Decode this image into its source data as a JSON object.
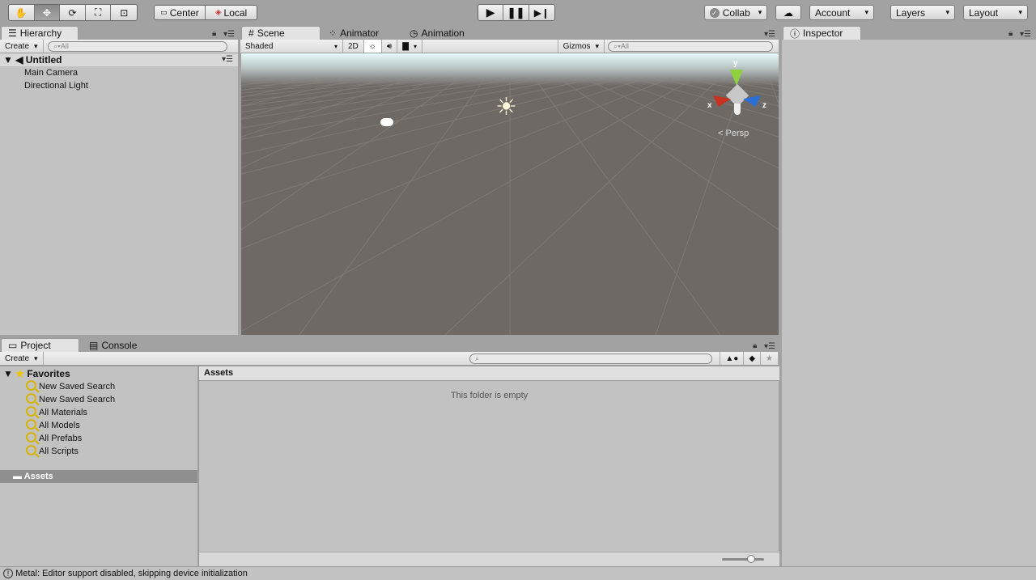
{
  "toolbar": {
    "transform_tools": [
      {
        "icon": "hand-icon",
        "glyph": "✋"
      },
      {
        "icon": "move-icon",
        "glyph": "✥",
        "active": true
      },
      {
        "icon": "rotate-icon",
        "glyph": "⟳"
      },
      {
        "icon": "scale-icon",
        "glyph": "⛶"
      },
      {
        "icon": "rect-icon",
        "glyph": "⊡"
      }
    ],
    "pivot": "Center",
    "space": "Local",
    "collab": "Collab",
    "account": "Account",
    "layers": "Layers",
    "layout": "Layout"
  },
  "hierarchy": {
    "tab": "Hierarchy",
    "create": "Create",
    "search_placeholder": "All",
    "scene": "Untitled",
    "items": [
      "Main Camera",
      "Directional Light"
    ]
  },
  "scene_tabs": [
    "Scene",
    "Animator",
    "Animation"
  ],
  "scene_toolbar": {
    "shading": "Shaded",
    "mode2d": "2D",
    "gizmos": "Gizmos",
    "search_placeholder": "All"
  },
  "scene_view": {
    "projection": "Persp",
    "axes": {
      "x": "x",
      "y": "y",
      "z": "z"
    },
    "colors": {
      "x": "#c8321e",
      "y": "#8fd13c",
      "z": "#2a6fd8"
    }
  },
  "inspector": {
    "tab": "Inspector"
  },
  "project": {
    "tabs": [
      "Project",
      "Console"
    ],
    "create": "Create",
    "favorites": "Favorites",
    "favorite_items": [
      "New Saved Search",
      "New Saved Search",
      "All Materials",
      "All Models",
      "All Prefabs",
      "All Scripts"
    ],
    "assets": "Assets",
    "breadcrumb": "Assets",
    "empty_message": "This folder is empty",
    "zoom_slider": 0.7
  },
  "status": {
    "message": "Metal: Editor support disabled, skipping device initialization"
  }
}
